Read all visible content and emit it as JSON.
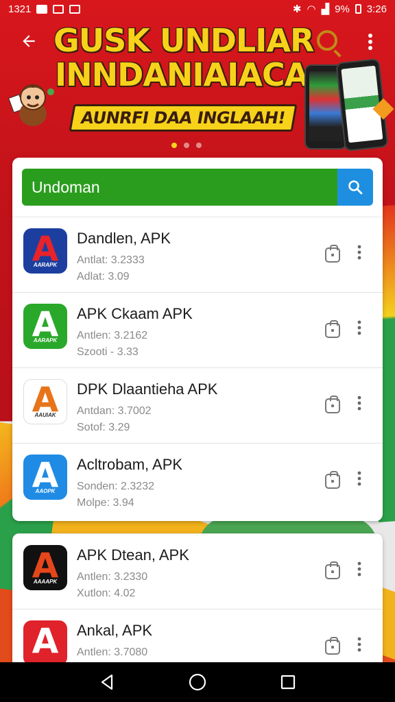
{
  "status_bar": {
    "time_left": "1321",
    "battery_text": "9%",
    "time_right": "3:26"
  },
  "header": {
    "back_icon": "arrow-left-icon",
    "more_icon": "more-vert-icon",
    "banner_title_line1": "GUSK UNDLIAR",
    "banner_title_line2": "INNDANIAIACA",
    "banner_ribbon": "AUNRFI DAA  INGLAAH!",
    "carousel_count": 3,
    "carousel_active": 0
  },
  "search": {
    "value": "Undoman",
    "button_icon": "search-icon"
  },
  "colors": {
    "search_green": "#2a9d1e",
    "search_blue": "#1e8fe0",
    "brand_red": "#c7161b",
    "banner_yellow": "#f7d21a"
  },
  "apps": [
    {
      "name": "Dandlen, APK",
      "meta1": "Antlat: 3.2333",
      "meta2": "Adlat: 3.09",
      "icon_letter": "A",
      "icon_sub": "AARAPK",
      "icon_bg": "#1c3f9f",
      "icon_fg": "#e8232a"
    },
    {
      "name": "APK Ckaam APK",
      "meta1": "Antlen: 3.2162",
      "meta2": "Szooti - 3.33",
      "icon_letter": "A",
      "icon_sub": "AARAPK",
      "icon_bg": "#2aa82a",
      "icon_fg": "#ffffff"
    },
    {
      "name": "DPK Dlaantieha APK",
      "meta1": "Antdan: 3.7002",
      "meta2": "Sotof: 3.29",
      "icon_letter": "A",
      "icon_sub": "AAUIAK",
      "icon_bg": "#ffffff",
      "icon_fg": "#e8741a"
    },
    {
      "name": "Acltrobam, APK",
      "meta1": "Sonden: 2.3232",
      "meta2": "Molpe: 3.94",
      "icon_letter": "A",
      "icon_sub": "AAOPK",
      "icon_bg": "#1f8be4",
      "icon_fg": "#ffffff"
    }
  ],
  "apps_more": [
    {
      "name": "APK Dtean, APK",
      "meta1": "Antlen: 3.2330",
      "meta2": "Xutlon: 4.02",
      "icon_letter": "A",
      "icon_sub": "AAAAPK",
      "icon_bg": "#111111",
      "icon_fg": "#e5461b"
    },
    {
      "name": "Ankal, APK",
      "meta1": "Antlen: 3.7080",
      "meta2": "",
      "icon_letter": "A",
      "icon_sub": "",
      "icon_bg": "#e0222a",
      "icon_fg": "#ffffff"
    }
  ],
  "row_icons": {
    "download": "download-bag-icon",
    "more": "more-vert-icon"
  },
  "nav": {
    "back": "nav-back-icon",
    "home": "nav-home-icon",
    "recents": "nav-recents-icon"
  }
}
